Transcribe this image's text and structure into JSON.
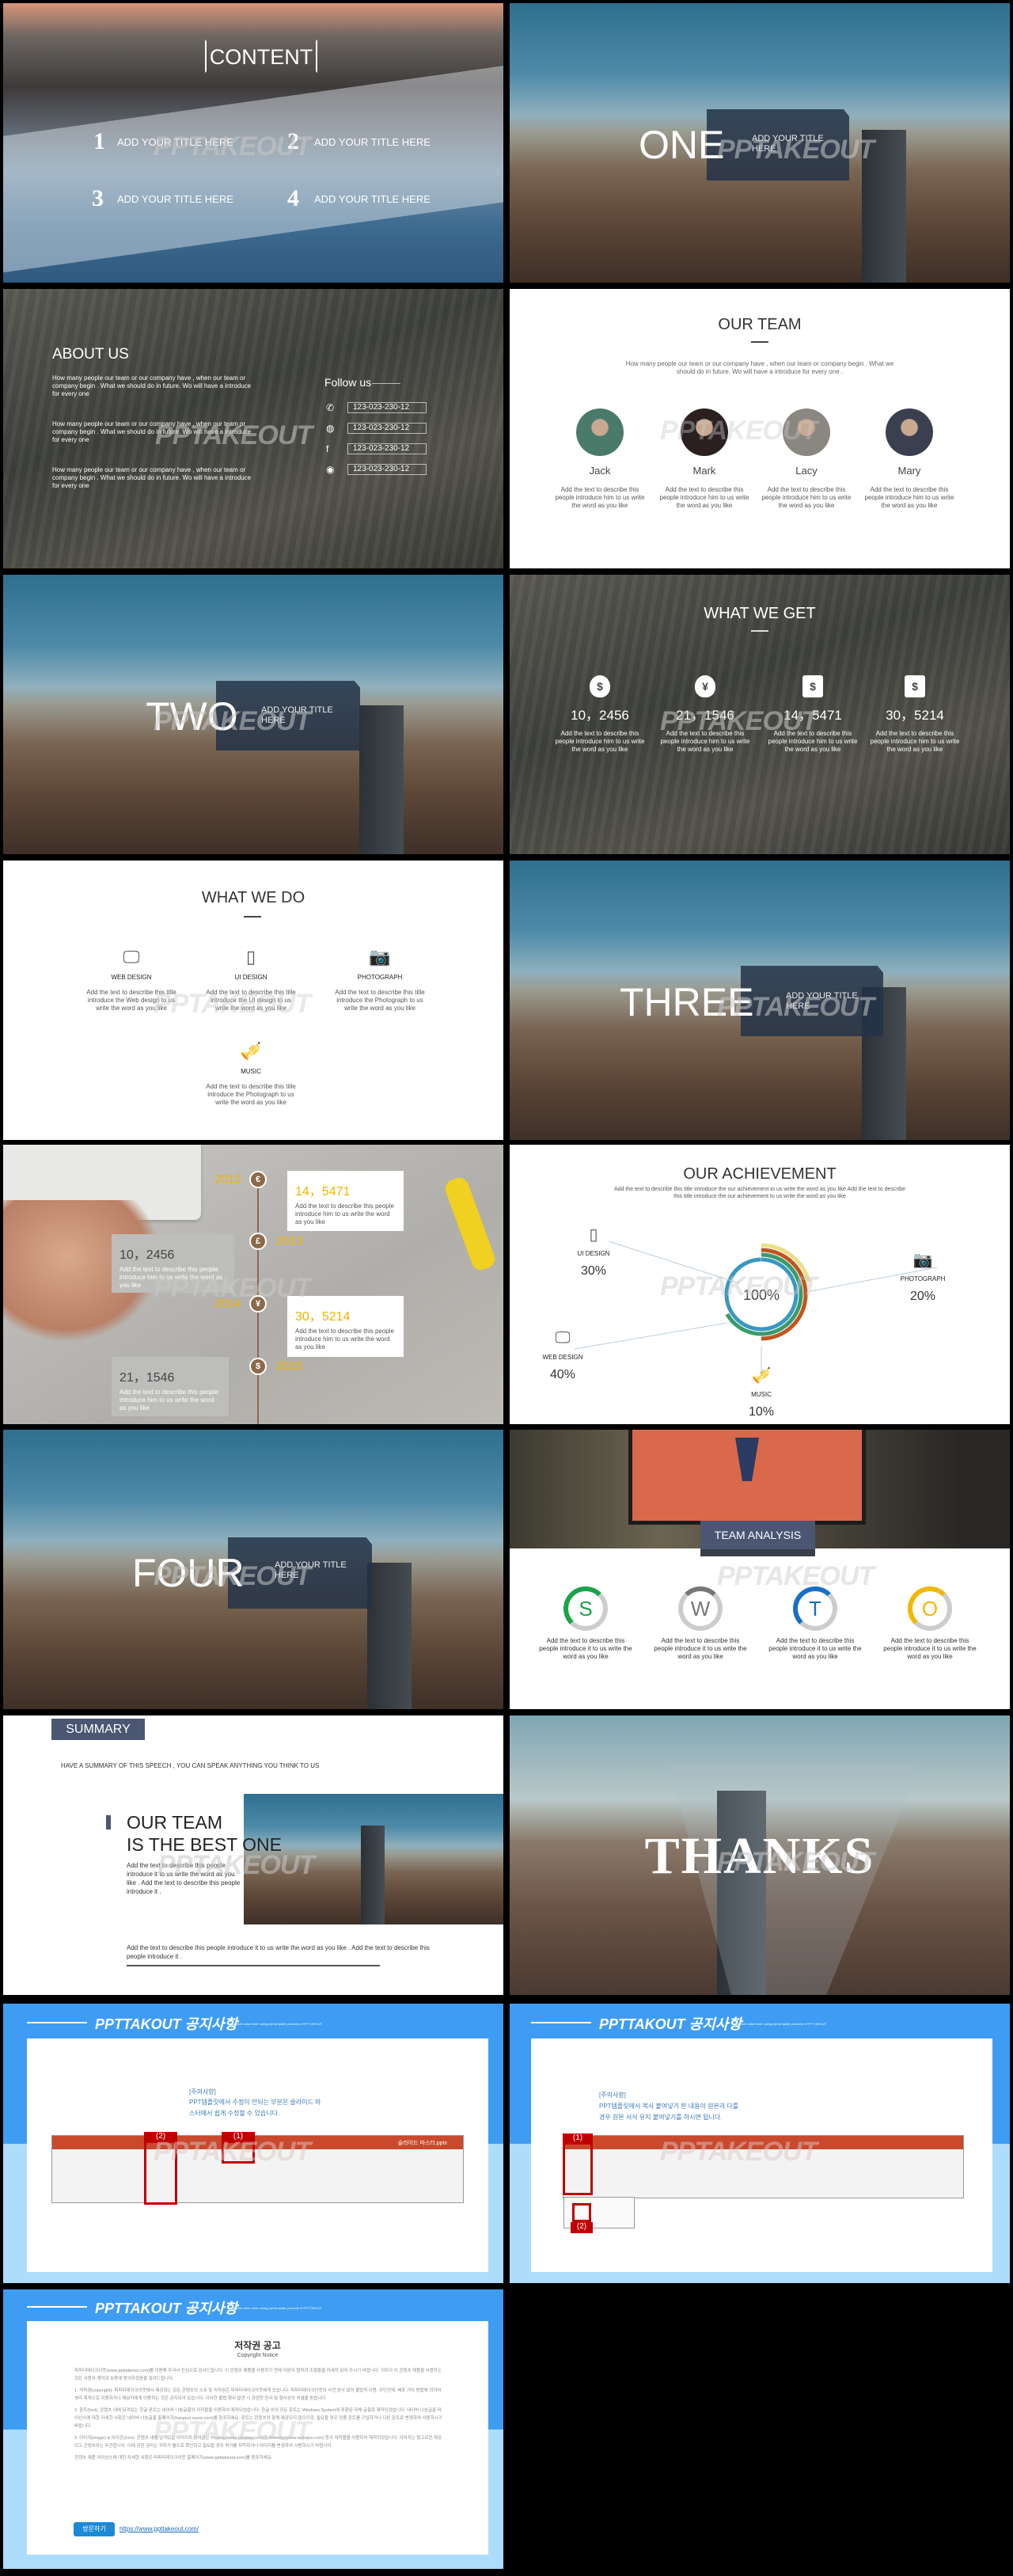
{
  "watermark": "PPTAKEOUT",
  "content": {
    "title": "CONTENT",
    "items": [
      {
        "num": "1",
        "label": "ADD YOUR TITLE HERE"
      },
      {
        "num": "2",
        "label": "ADD YOUR TITLE HERE"
      },
      {
        "num": "3",
        "label": "ADD YOUR TITLE HERE"
      },
      {
        "num": "4",
        "label": "ADD YOUR TITLE HERE"
      }
    ]
  },
  "sections": [
    {
      "big": "ONE",
      "sub": "ADD YOUR TITLE HERE"
    },
    {
      "big": "TWO",
      "sub": "ADD YOUR TITLE HERE"
    },
    {
      "big": "THREE",
      "sub": "ADD YOUR TITLE HERE"
    },
    {
      "big": "FOUR",
      "sub": "ADD YOUR TITLE HERE"
    }
  ],
  "about": {
    "title": "ABOUT US",
    "paragraphs": [
      "How many people our team or our company have , when our team or company begin . What we should do in future. Wo will have a introduce for every one",
      "How many people our team or our company have , when our team or company begin . What we should do in future. Wo will have a introduce for every one",
      "How many people our team or our company have , when our team or company begin . What we should do in future. Wo will have a introduce for every one"
    ],
    "follow": "Follow us",
    "contacts": [
      {
        "icon": "phone-icon",
        "value": "123-023-230-12"
      },
      {
        "icon": "wechat-icon",
        "value": "123-023-230-12"
      },
      {
        "icon": "facebook-icon",
        "value": "123-023-230-12"
      },
      {
        "icon": "weibo-icon",
        "value": "123-023-230-12"
      }
    ]
  },
  "team": {
    "title": "OUR TEAM",
    "intro": "How many people our team or our company have , when our team or company begin . What we should do in future. Wo will have a introduce for every one .",
    "members": [
      {
        "name": "Jack",
        "desc": "Add the text to describe this people introduce him to us write the word as you like"
      },
      {
        "name": "Mark",
        "desc": "Add the text to describe this people introduce him to us write the word as you like"
      },
      {
        "name": "Lacy",
        "desc": "Add the text to describe this people introduce him to us write the word as you like"
      },
      {
        "name": "Mary",
        "desc": "Add the text to describe this people introduce him to us write the word as you like"
      }
    ]
  },
  "get": {
    "title": "WHAT WE GET",
    "items": [
      {
        "icon": "money-bag-dollar-icon",
        "glyph": "$",
        "value": "10，2456",
        "desc": "Add the text to describe this people introduce him to us write the word as you like"
      },
      {
        "icon": "money-bag-yen-icon",
        "glyph": "¥",
        "value": "21，1546",
        "desc": "Add the text to describe this people introduce him to us write the word as you like"
      },
      {
        "icon": "briefcase-dollar-icon",
        "glyph": "$",
        "value": "14，5471",
        "desc": "Add the text to describe this people introduce him to us write the word as you like"
      },
      {
        "icon": "case-coin-icon",
        "glyph": "$",
        "value": "30，5214",
        "desc": "Add the text to describe this people introduce him to us write the word as you like"
      }
    ]
  },
  "do": {
    "title": "WHAT WE DO",
    "items": [
      {
        "icon": "monitor-icon",
        "label": "WEB DESIGN",
        "desc": "Add the text to describe this title introduce the Web design to us write the word as you like"
      },
      {
        "icon": "smartphone-icon",
        "label": "UI DESIGN",
        "desc": "Add the text to describe this title introduce the UI design to us write the word as you like"
      },
      {
        "icon": "camera-icon",
        "label": "PHOTOGRAPH",
        "desc": "Add the text to describe this title introduce the Photograph to us write the word as you like"
      },
      {
        "icon": "trumpet-icon",
        "label": "MUSIC",
        "desc": "Add the text to describe this title introduce the Photograph to us write the word as you like"
      }
    ]
  },
  "timeline": {
    "accent": "#f0b400",
    "line": "#8a6a4a",
    "events": [
      {
        "year": "2012",
        "icon": "euro-icon",
        "glyph": "€"
      },
      {
        "year": "2013",
        "icon": "pound-icon",
        "glyph": "£"
      },
      {
        "year": "2014",
        "icon": "yen-icon",
        "glyph": "¥"
      },
      {
        "year": "2015",
        "icon": "dollar-icon",
        "glyph": "$"
      }
    ],
    "cards": [
      {
        "value": "14，5471",
        "desc": "Add the text to describe this people introduce him to us write the word as you like"
      },
      {
        "value": "10，2456",
        "desc": "Add the text to describe this people introduce him to us write the word as you like"
      },
      {
        "value": "30，5214",
        "desc": "Add the text to describe this people introduce him to us write the word as you like"
      },
      {
        "value": "21，1546",
        "desc": "Add the text to describe this people introduce him to us write the word as you like"
      }
    ]
  },
  "achievement": {
    "title": "OUR ACHIEVEMENT",
    "desc": "Add the text to describe this title introduce the our achievement to us write the word as you like Add the text to describe this title introduce the our achievement to us write the word as you like",
    "center": "100%",
    "items": [
      {
        "icon": "smartphone-icon",
        "label": "UI DESIGN",
        "value": "30%"
      },
      {
        "icon": "camera-icon",
        "label": "PHOTOGRAPH",
        "value": "20%"
      },
      {
        "icon": "monitor-icon",
        "label": "WEB DESIGN",
        "value": "40%"
      },
      {
        "icon": "trumpet-icon",
        "label": "MUSIC",
        "value": "10%"
      }
    ],
    "ring_colors": [
      "#3a98c0",
      "#3a9a6a",
      "#c0561e",
      "#e8e08a"
    ]
  },
  "analysis": {
    "title": "TEAM ANALYSIS",
    "items": [
      {
        "letter": "S",
        "color": "#1aa34a",
        "desc": "Add the text to describe this people introduce it to us write the word as you like"
      },
      {
        "letter": "W",
        "color": "#777777",
        "desc": "Add the text to describe this people introduce it to us write the word as you like"
      },
      {
        "letter": "T",
        "color": "#1670c8",
        "desc": "Add the text to describe this people introduce it to us write the word as you like"
      },
      {
        "letter": "O",
        "color": "#f2b800",
        "desc": "Add the text to describe this people introduce it to us write the word as you like"
      }
    ]
  },
  "summary": {
    "tag": "SUMMARY",
    "lead": "HAVE A SUMMARY OF THIS SPEECH , YOU CAN SPEAK ANYTHING YOU THINK TO US",
    "heading1": "OUR TEAM",
    "heading2": "IS THE BEST ONE",
    "desc": "Add the text to describe this people introduce it to us write the word as you like . Add the text to describe this people introduce it .",
    "bottom": "Add the text to describe this people introduce it to us write the word as you like . Add the text to describe this people introduce it ."
  },
  "thanks": {
    "text": "THANKS"
  },
  "notice": {
    "brand": "PPTTAKOUT 공지사항",
    "subtitle": "Special notice when using ppt template products of PPTTAKOUT",
    "note1": {
      "label": "[주의사항]",
      "line1": "PPT템플릿에서 수정이 안되는 부분은 슬라이드 마",
      "line2": "스터에서 쉽게 수정할 수 있습니다.",
      "tags": [
        "(2)",
        "(1)"
      ],
      "file": "슬라이드 마스터.pptx"
    },
    "note2": {
      "label": "[주의사항]",
      "line1": "PPT템플릿에서 복사 붙여넣기 한 내용이 원본과 다를",
      "line2": "경우 원본 서식 유지 붙여넣기를 하시면 됩니다.",
      "tags": [
        "(1)",
        "(2)"
      ]
    },
    "copyright": {
      "title": "저작권 공고",
      "subtitle": "Copyright Notice",
      "paragraphs": [
        "피피티테이크아웃(www.ppttakeout.com)를 이용해 주셔서 진심으로 감사드립니다. 이 콘텐츠 제품을 사용하기 전에 다음의 협약과 조항들을 자세히 읽어 주시기 바랍니다. 귀하가 이 콘텐츠 제품을 사용하는 것은 사용자 계약과 보증에 동의하셨음을 알려드립니다.",
        "1. 저작권(copyright): 피피티테이크아웃에서 제공하는 모든 콘텐츠의 소유 및 저작권은 피피티테이크아웃에게 있습니다. 피피티테이크아웃의 사전 승낙 없이 불법적 이용, 무단전재, 배포 기타 방법에 의하여 영리 목적으로 이용하거나 제삼자에게 이용하는 것은 금지되어 있습니다. 이러한 불법 행위 발견 시 관련한 민사 및 형사상의 처벌을 받습니다.",
        "2. 폰트(font): 콘텐츠 내에 담겨있는 한글 폰트는 네이버 나눔글꼴의 저작물을 이용하여 제작되었습니다. 한글 외의 모든 폰트는 Windows System에 포함된 자체 글꼴로 제작되었습니다. 네이버 나눔글꼴 라이선스에 대한 자세한 사항은 네이버 나눔글꼴 홈페이지(hangeul.naver.com)를 참조하세요. 폰트는 콘텐츠와 함께 제공되지 않으므로, 필요할 경우 정품 폰트를 구입하거나 다른 폰트로 변경하여 사용하시기 바랍니다.",
        "3. 이미지(image) & 아이콘(icon): 콘텐츠 내에 담겨있는 이미지와 아이콘은 Pixabay(www.pixabay.com)와 Webalys(www.webalys.com) 등의 저작물을 이용하여 제작되었습니다. 이미지는 참고로만 제공되고 콘텐츠와는 무관합니다. 이에 관한 권리는 귀하가 별도로 확인하고 필요할 경우 허가를 취득하거나 이미지를 변경하여 사용하시기 바랍니다.",
        "콘텐츠 제품 라이선스에 대한 자세한 사항은 피피티테이크아웃 홈페이지(www.ppttakeout.com)를 참조하세요."
      ],
      "button": "방문하기",
      "link": "https://www.ppttakeout.com/"
    }
  }
}
